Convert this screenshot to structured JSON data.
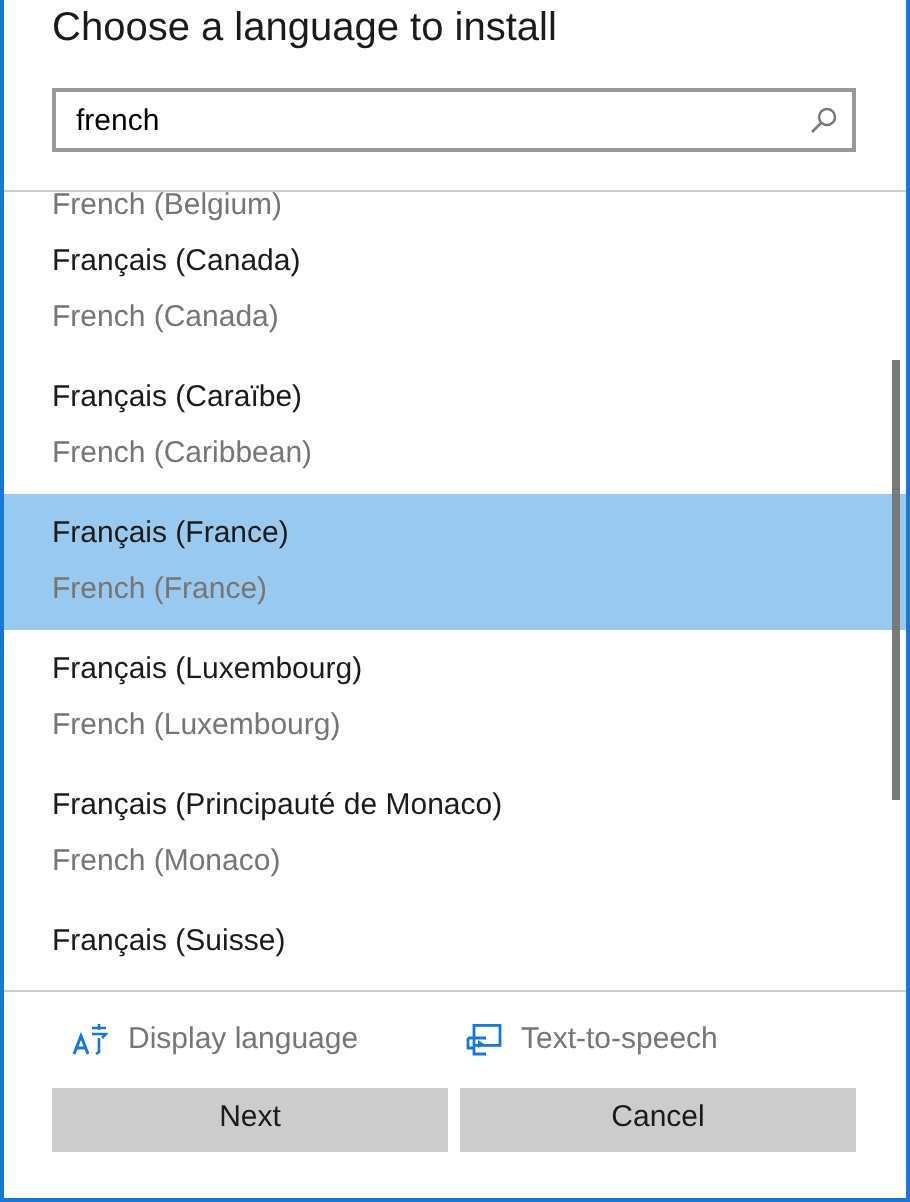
{
  "title": "Choose a language to install",
  "search": {
    "value": "french"
  },
  "languages": [
    {
      "english": "French (Belgium)",
      "selected": false,
      "partial": true
    },
    {
      "name": "Français (Canada)",
      "english": "French (Canada)",
      "selected": false
    },
    {
      "name": "Français (Caraïbe)",
      "english": "French (Caribbean)",
      "selected": false
    },
    {
      "name": "Français (France)",
      "english": "French (France)",
      "selected": true
    },
    {
      "name": "Français (Luxembourg)",
      "english": "French (Luxembourg)",
      "selected": false
    },
    {
      "name": "Français (Principauté de Monaco)",
      "english": "French (Monaco)",
      "selected": false
    },
    {
      "name": "Français (Suisse)",
      "selected": false
    }
  ],
  "features": [
    {
      "kind": "display",
      "label": "Display language"
    },
    {
      "kind": "speech",
      "label": "Text-to-speech"
    }
  ],
  "buttons": [
    "Next",
    "Cancel"
  ]
}
